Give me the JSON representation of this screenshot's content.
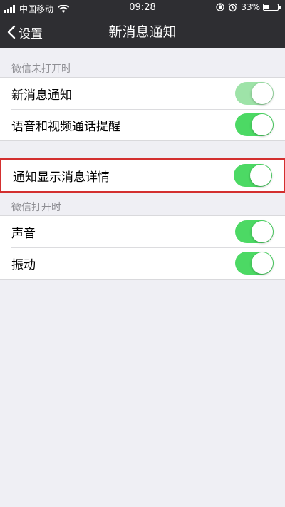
{
  "status_bar": {
    "carrier": "中国移动",
    "time": "09:28",
    "battery_percent": "33%",
    "battery_level": 0.33
  },
  "nav": {
    "back_label": "设置",
    "title": "新消息通知"
  },
  "sections": {
    "closed_header": "微信未打开时",
    "open_header": "微信打开时"
  },
  "rows": {
    "new_message": {
      "label": "新消息通知",
      "on": true
    },
    "voice_video": {
      "label": "语音和视频通话提醒",
      "on": true
    },
    "show_details": {
      "label": "通知显示消息详情",
      "on": true
    },
    "sound": {
      "label": "声音",
      "on": true
    },
    "vibrate": {
      "label": "振动",
      "on": true
    }
  },
  "colors": {
    "toggle_on": "#4cd964",
    "highlight_border": "#d32f2f",
    "nav_bg": "#2e2e32"
  }
}
